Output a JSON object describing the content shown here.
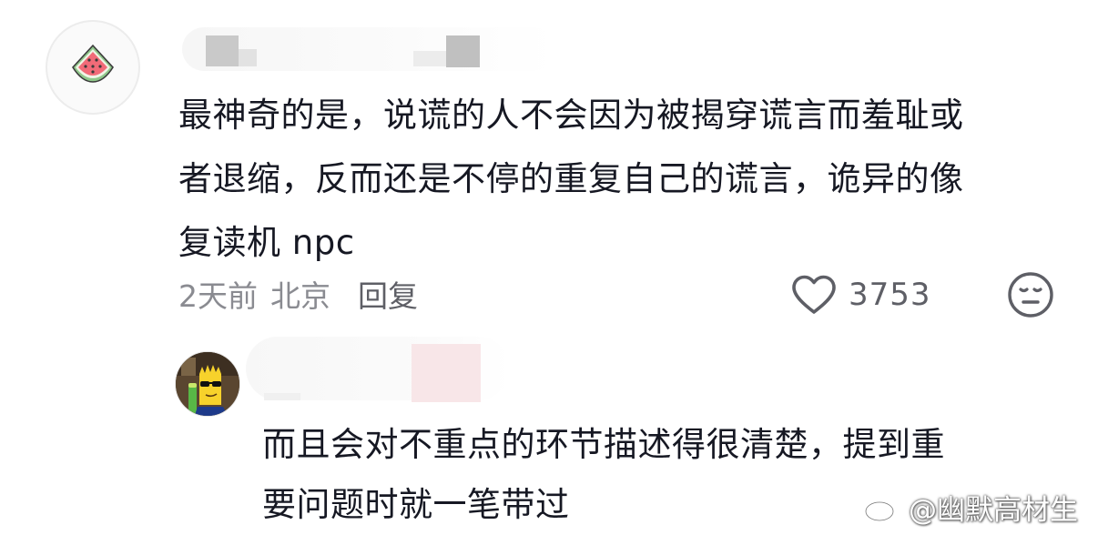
{
  "main_comment": {
    "avatar_icon": "watermelon-icon",
    "text": "最神奇的是，说谎的人不会因为被揭穿谎言而羞耻或\n者退缩，反而还是不停的重复自己的谎言，诡异的像\n复读机 npc",
    "time": "2天前",
    "location": "北京",
    "reply_label": "回复",
    "like_icon": "heart-outline-icon",
    "like_count": "3753",
    "dislike_icon": "meh-face-icon"
  },
  "reply_comment": {
    "avatar_icon": "cartoon-avatar",
    "text": "而且会对不重点的环节描述得很清楚，提到重\n要问题时就一笔带过"
  },
  "watermark": {
    "icon": "weibo-logo",
    "text": "@幽默高材生"
  },
  "colors": {
    "text_primary": "#161823",
    "text_secondary": "#8a8b91",
    "icon_gray": "#5e5f66"
  }
}
